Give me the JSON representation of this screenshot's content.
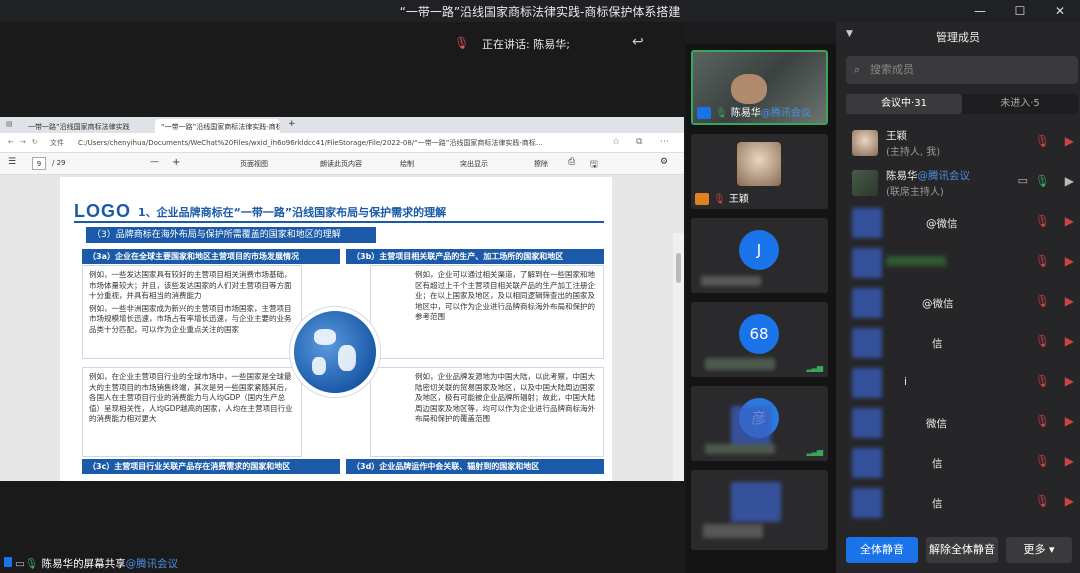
{
  "window": {
    "title": "“一带一路”沿线国家商标法律实践-商标保护体系搭建",
    "minimize": "—",
    "maximize": "☐",
    "close": "✕"
  },
  "stage": {
    "speaking_label": "正在讲话: 陈易华;",
    "share_label_name": "陈易华的屏幕共享",
    "share_label_tag": "@腾讯会议"
  },
  "browser": {
    "tabs": [
      "一带一路”沿线国家商标法律实践",
      "“一带一路”沿线国家商标法律实践-商标保"
    ],
    "new_tab": "+",
    "file_label": "文件",
    "url": "C:/Users/chenyihua/Documents/WeChat%20Files/wxid_ih6o96rkldcc41/FileStorage/File/2022-08/“一带一路”沿线国家商标法律实践-商标..."
  },
  "pdf_toolbar": {
    "page_current": "9",
    "page_total": "/ 29",
    "zoom_out": "—",
    "zoom_in": "+",
    "fit_label": "页面视图",
    "read_aloud": "朗读此页内容",
    "draw": "绘制",
    "highlight": "突出显示",
    "erase": "擦除"
  },
  "slide": {
    "logo": "LOGO",
    "heading": "1、企业品牌商标在“一带一路”沿线国家布局与保护需求的理解",
    "subheading": "（3）品牌商标在海外布局与保护所需覆盖的国家和地区的理解",
    "q3a": {
      "title": "（3a）企业在全球主要国家和地区主营项目的市场发展情况",
      "p1": "例如，一些发达国家具有较好的主营项目相关消费市场基础，市场体量较大；并且，该些发达国家的人们对主营项目等方面十分重视，并具有相当的消费能力",
      "p2": "例如，一些非洲国家成为新兴的主营项目市场国家，主营项目市场规模增长迅速，市场占有率增长迅速，与企业主要的业务品类十分匹配，可以作为企业重点关注的国家"
    },
    "q3b": {
      "title": "（3b）主营项目相关联产品的生产、加工场所的国家和地区",
      "p1": "例如，企业可以通过相关渠道，了解到在一些国家和地区有超过上千个主营项目相关联产品的生产加工注册企业；在以上国家及地区，及以相同逻辑筛查出的国家及地区中，可以作为企业进行品牌商标海外布局和保护的参考范围"
    },
    "q3c": {
      "title": "（3c）主营项目行业关联产品存在消费需求的国家和地区",
      "p1": "例如，在企业主营项目行业的全球市场中，一些国家是全球最大的主营项目的市场销售终端，其次是另一些国家紧随其后，各国人在主营项目行业的消费能力与人均GDP（国内生产总值）呈现相关性，人均GDP越高的国家，人均在主营项目行业的消费能力相对更大"
    },
    "q3d": {
      "title": "（3d）企业品牌运作中会关联、辐射到的国家和地区",
      "p1": "例如，企业品牌发源地为中国大陆，以此考察，中国大陆密切关联的贸易国家及地区，以及中国大陆周边国家及地区，极有可能被企业品牌所辐射；故此，中国大陆周边国家及地区等，均可以作为企业进行品牌商标海外布局和保护的覆盖范围"
    }
  },
  "videos": [
    {
      "name": "陈易华",
      "tag": "@腾讯会议"
    },
    {
      "name": "王颖"
    },
    {
      "letter": "J"
    },
    {
      "letter": "68"
    },
    {
      "letter": "彦"
    }
  ],
  "panel": {
    "title": "管理成员",
    "search_placeholder": "搜索成员",
    "tab_in": "会议中·31",
    "tab_out": "未进入·5",
    "members": [
      {
        "name": "王颖",
        "role": "(主持人, 我)"
      },
      {
        "name": "陈易华",
        "tag": "@腾讯会议",
        "role": "(联席主持人)"
      },
      {
        "tag": "@微信"
      },
      {
        "tag": ""
      },
      {
        "tag": "@微信"
      },
      {
        "tag": "信"
      },
      {
        "tag": "i"
      },
      {
        "tag": "微信"
      },
      {
        "tag": "信"
      },
      {
        "tag": "信"
      }
    ],
    "mute_all": "全体静音",
    "unmute_all": "解除全体静音",
    "more": "更多 ▾"
  },
  "colors": {
    "accent": "#1a73e8",
    "slide_blue": "#1a5aa8",
    "green": "#3ba55c",
    "muted_red": "#cc4444"
  }
}
